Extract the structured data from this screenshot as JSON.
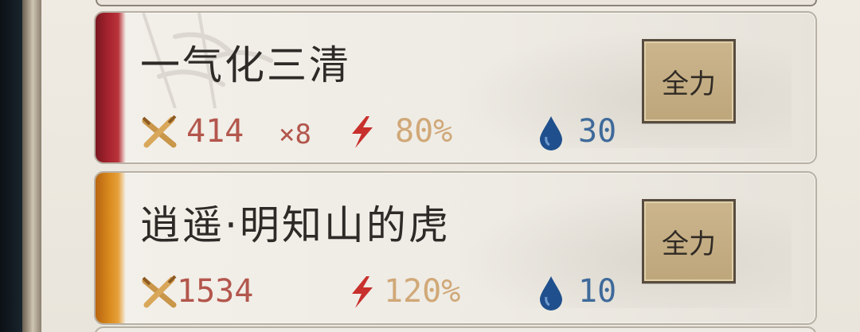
{
  "skills": [
    {
      "name": "一气化三清",
      "damage": "414",
      "multiplier": "×8",
      "rate": "80%",
      "cost": "30",
      "button_label": "全力",
      "accent_color": "#a82430"
    },
    {
      "name": "逍遥·明知山的虎",
      "damage": "1534",
      "multiplier": "",
      "rate": "120%",
      "cost": "10",
      "button_label": "全力",
      "accent_color": "#d98a1e"
    }
  ],
  "icons": {
    "damage": "crossed-swords-icon",
    "rate": "lightning-icon",
    "cost": "water-drop-icon"
  },
  "colors": {
    "damage_text": "#b3564c",
    "rate_text": "#d0a878",
    "cost_text": "#3f6a9a",
    "button_bg": "#c4ad82"
  }
}
